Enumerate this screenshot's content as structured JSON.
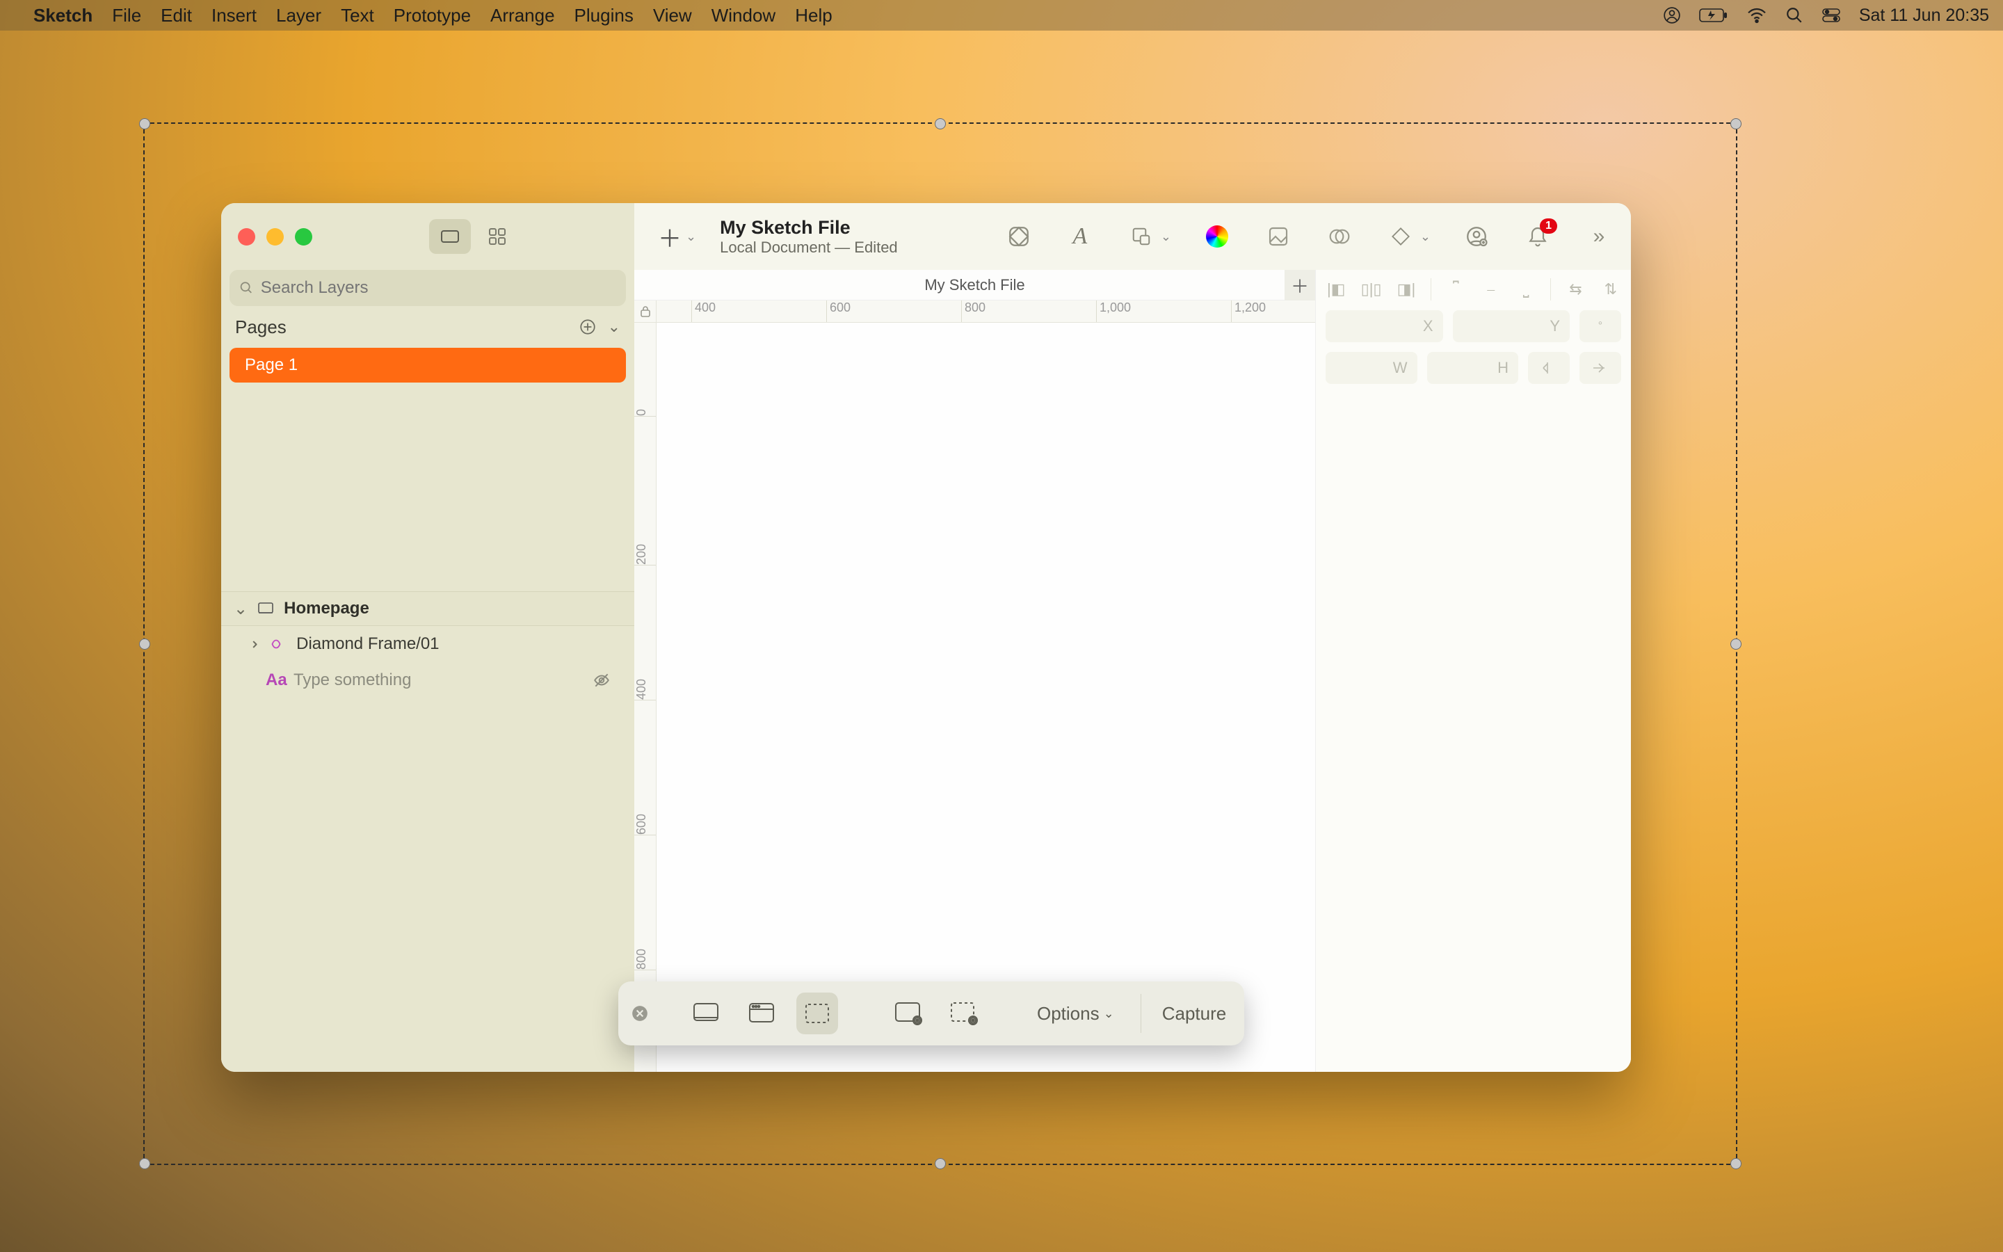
{
  "menubar": {
    "app": "Sketch",
    "items": [
      "File",
      "Edit",
      "Insert",
      "Layer",
      "Text",
      "Prototype",
      "Arrange",
      "Plugins",
      "View",
      "Window",
      "Help"
    ],
    "datetime": "Sat 11 Jun  20:35"
  },
  "sketch": {
    "doc_title": "My Sketch File",
    "doc_subtitle": "Local Document — Edited",
    "notification_badge": "1",
    "search_placeholder": "Search Layers",
    "pages_label": "Pages",
    "pages": [
      "Page 1"
    ],
    "tab_name": "My Sketch File",
    "artboard": "Homepage",
    "layers": [
      {
        "name": "Diamond Frame/01",
        "type": "group",
        "hidden": false
      },
      {
        "name": "Type something",
        "type": "text",
        "hidden": true
      }
    ],
    "inspector": {
      "x_label": "X",
      "y_label": "Y",
      "w_label": "W",
      "h_label": "H"
    },
    "ruler_h": [
      "400",
      "600",
      "800",
      "1,000",
      "1,200"
    ],
    "ruler_v": [
      "0",
      "200",
      "400",
      "600",
      "800"
    ]
  },
  "screenshot_bar": {
    "options": "Options",
    "capture": "Capture"
  }
}
